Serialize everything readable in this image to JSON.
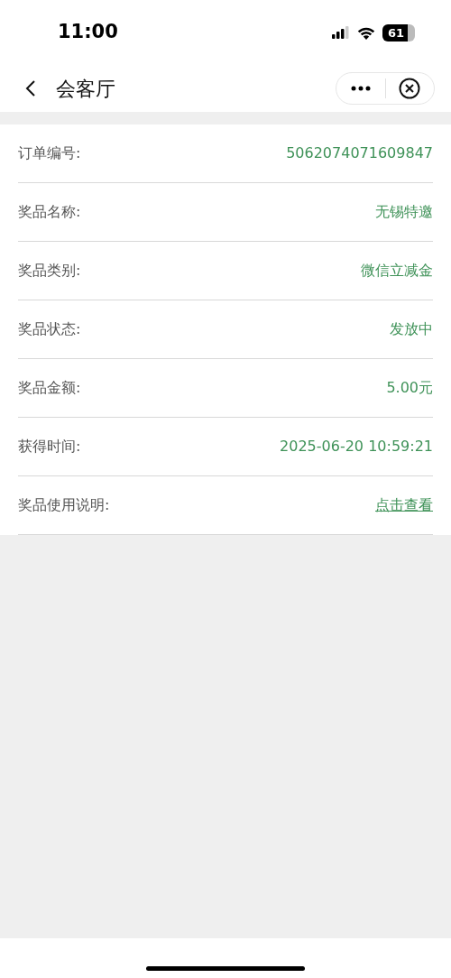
{
  "status_bar": {
    "time": "11:00",
    "battery": "61"
  },
  "header": {
    "title": "会客厅"
  },
  "rows": [
    {
      "label": "订单编号:",
      "value": "5062074071609847",
      "kind": "text"
    },
    {
      "label": "奖品名称:",
      "value": "无锡特邀",
      "kind": "text"
    },
    {
      "label": "奖品类别:",
      "value": "微信立减金",
      "kind": "text"
    },
    {
      "label": "奖品状态:",
      "value": "发放中",
      "kind": "text"
    },
    {
      "label": "奖品金额:",
      "value": "5.00元",
      "kind": "text"
    },
    {
      "label": "获得时间:",
      "value": "2025-06-20 10:59:21",
      "kind": "text"
    },
    {
      "label": "奖品使用说明:",
      "value": "点击查看",
      "kind": "link"
    }
  ]
}
